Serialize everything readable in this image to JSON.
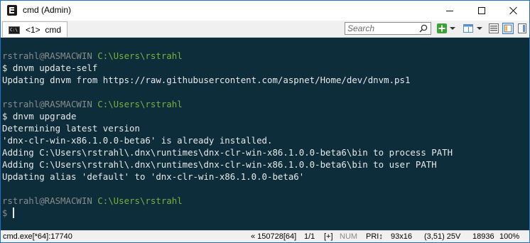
{
  "window": {
    "title": "cmd (Admin)"
  },
  "titlebar": {
    "app_icon": "cmd-app-icon",
    "controls": [
      "minimize-icon",
      "maximize-icon",
      "close-icon"
    ]
  },
  "tabs": [
    {
      "label": "<1>  cmd"
    }
  ],
  "toolbar": {
    "search_placeholder": "Search",
    "icons": [
      "search-icon",
      "add-console-icon",
      "split-pane-icon",
      "view-icon"
    ]
  },
  "console": {
    "lines": [
      {
        "type": "prompt",
        "user": "rstrahl@RASMACWIN",
        "path": "C:\\Users\\rstrahl"
      },
      {
        "type": "text",
        "text": "$ dnvm update-self"
      },
      {
        "type": "text",
        "text": "Updating dnvm from https://raw.githubusercontent.com/aspnet/Home/dev/dnvm.ps1"
      },
      {
        "type": "blank",
        "text": ""
      },
      {
        "type": "prompt",
        "user": "rstrahl@RASMACWIN",
        "path": "C:\\Users\\rstrahl"
      },
      {
        "type": "text",
        "text": "$ dnvm upgrade"
      },
      {
        "type": "text",
        "text": "Determining latest version"
      },
      {
        "type": "text",
        "text": "'dnx-clr-win-x86.1.0.0-beta6' is already installed."
      },
      {
        "type": "text",
        "text": "Adding C:\\Users\\rstrahl\\.dnx\\runtimes\\dnx-clr-win-x86.1.0.0-beta6\\bin to process PATH"
      },
      {
        "type": "text",
        "text": "Adding C:\\Users\\rstrahl\\.dnx\\runtimes\\dnx-clr-win-x86.1.0.0-beta6\\bin to user PATH"
      },
      {
        "type": "text",
        "text": "Updating alias 'default' to 'dnx-clr-win-x86.1.0.0-beta6'"
      },
      {
        "type": "blank",
        "text": ""
      },
      {
        "type": "prompt",
        "user": "rstrahl@RASMACWIN",
        "path": "C:\\Users\\rstrahl"
      },
      {
        "type": "input",
        "text": "$"
      }
    ],
    "colors": {
      "background": "#0c2d39",
      "text": "#e9e9e9",
      "user": "#8b8b8b",
      "path": "#78b13f"
    }
  },
  "statusbar": {
    "process": "cmd.exe[*64]:17740",
    "position": "« 150728[64]",
    "page": "1/1",
    "insert": "[+]",
    "num": "NUM",
    "priority": "PRI↕",
    "size": "93x16",
    "cursor": "(3,51) 25V",
    "pid": "18936",
    "zoom": "100%"
  }
}
